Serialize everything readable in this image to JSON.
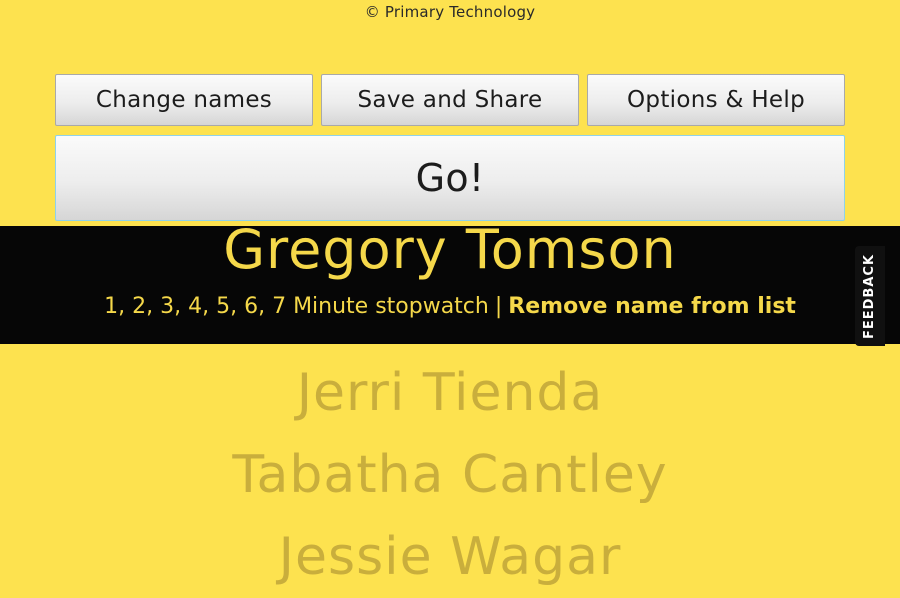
{
  "credit": "© Primary Technology",
  "toolbar": {
    "change_names": "Change names",
    "save_and_share": "Save and Share",
    "options_help": "Options & Help",
    "go": "Go!"
  },
  "selected": {
    "name": "Gregory Tomson",
    "minutes": [
      "1",
      "2",
      "3",
      "4",
      "5",
      "6",
      "7"
    ],
    "stopwatch_suffix": "Minute stopwatch",
    "separator": "|",
    "remove_label": "Remove name from list"
  },
  "feedback_label": "FEEDBACK",
  "remaining_names": [
    "Jerri Tienda",
    "Tabatha Cantley",
    "Jessie Wagar"
  ],
  "colors": {
    "background": "#fde24f",
    "band": "#060606",
    "highlight_text": "#f5d84a",
    "faded_name": "#c9ae3c"
  }
}
